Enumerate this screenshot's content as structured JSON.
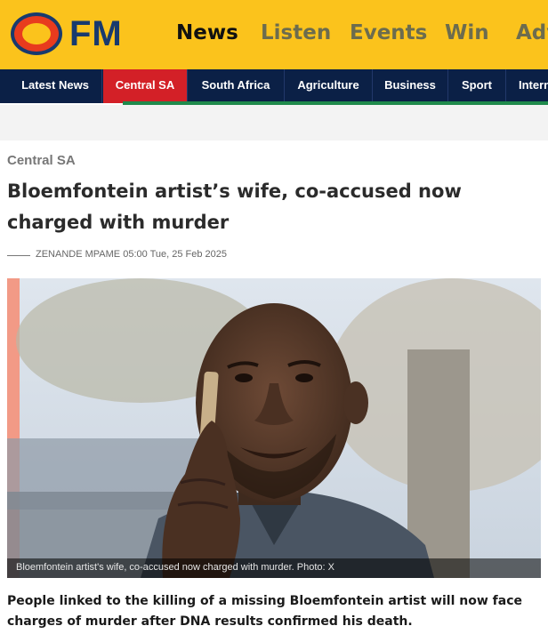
{
  "brand": {
    "logo_text": "FM",
    "colors": {
      "header_bg": "#fbc31c",
      "navy": "#0b2046",
      "accent_red": "#d32027",
      "green": "#1f8a4c"
    }
  },
  "main_nav": [
    {
      "label": "News",
      "active": true
    },
    {
      "label": "Listen",
      "active": false
    },
    {
      "label": "Events",
      "active": false
    },
    {
      "label": "Win",
      "active": false
    },
    {
      "label": "Adv",
      "active": false
    }
  ],
  "categories": [
    {
      "label": "Latest News",
      "active": false
    },
    {
      "label": "Central SA",
      "active": true
    },
    {
      "label": "South Africa",
      "active": false
    },
    {
      "label": "Agriculture",
      "active": false
    },
    {
      "label": "Business",
      "active": false
    },
    {
      "label": "Sport",
      "active": false
    },
    {
      "label": "Intern",
      "active": false
    }
  ],
  "article": {
    "category": "Central SA",
    "headline": "Bloemfontein artist’s wife, co-accused now charged with murder",
    "author": "ZENANDE MPAME",
    "time": "05:00",
    "date": "Tue, 25 Feb 2025",
    "image_icon": "news-photo-man-on-phone",
    "caption": "Bloemfontein artist's wife, co-accused now charged with murder. Photo: X",
    "lead": "People linked to the killing of a missing Bloemfontein artist will now face charges of murder after DNA results confirmed his death."
  }
}
